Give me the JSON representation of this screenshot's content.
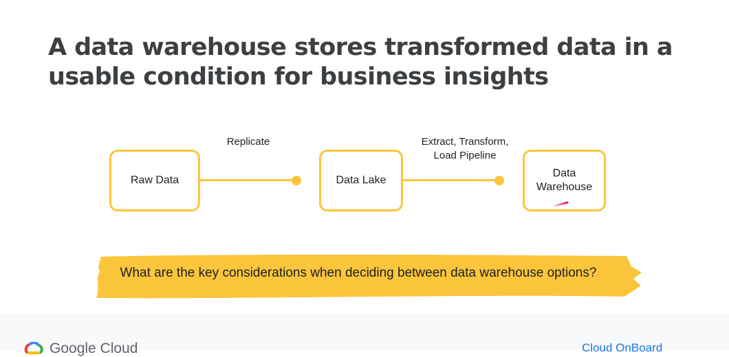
{
  "slide": {
    "title_line1": "A data warehouse stores transformed data in a",
    "title_line2": "usable condition for business insights"
  },
  "diagram": {
    "nodes": [
      {
        "id": "raw",
        "label": "Raw Data"
      },
      {
        "id": "lake",
        "label": "Data Lake"
      },
      {
        "id": "warehouse",
        "label_line1": "Data",
        "label_line2": "Warehouse"
      }
    ],
    "edges": [
      {
        "from": "raw",
        "to": "lake",
        "label": "Replicate"
      },
      {
        "from": "lake",
        "to": "warehouse",
        "label_line1": "Extract, Transform,",
        "label_line2": "Load Pipeline"
      }
    ]
  },
  "banner": {
    "question": "What are the key considerations when deciding between data warehouse options?"
  },
  "footer": {
    "brand": "Google Cloud",
    "program": "Cloud OnBoard"
  },
  "colors": {
    "accent": "#fbc53c",
    "title": "#3c4043",
    "link": "#1a73e8",
    "laser": "#e8194b"
  }
}
